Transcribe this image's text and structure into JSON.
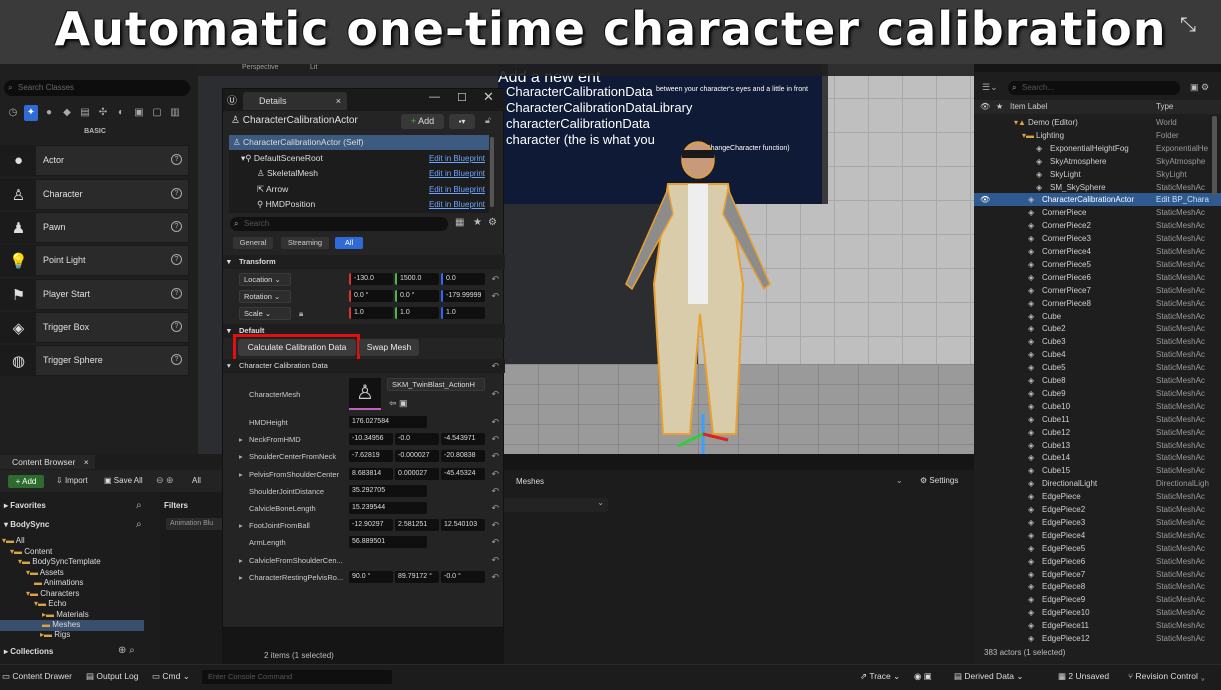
{
  "banner": {
    "title": "Automatic one-time character calibration"
  },
  "place_actors": {
    "search_placeholder": "Search Classes",
    "section": "BASIC",
    "items": [
      {
        "label": "Actor",
        "icon": "sphere-icon"
      },
      {
        "label": "Character",
        "icon": "character-icon"
      },
      {
        "label": "Pawn",
        "icon": "pawn-icon"
      },
      {
        "label": "Point Light",
        "icon": "point-light-icon"
      },
      {
        "label": "Player Start",
        "icon": "player-start-icon"
      },
      {
        "label": "Trigger Box",
        "icon": "trigger-box-icon"
      },
      {
        "label": "Trigger Sphere",
        "icon": "trigger-sphere-icon"
      }
    ]
  },
  "viewport": {
    "perspective_label": "Perspective",
    "lit_label": "Lit",
    "board_lines": [
      "Add a new ent",
      "CharacterCalibrationData",
      "CharacterCalibrationDataLibrary",
      "characterCalibrationData",
      "character (the is what you"
    ],
    "board_right_1": "between your character's eyes and a little in front",
    "board_right_2": "o the ChangeCharacter function)"
  },
  "details": {
    "tab": "Details",
    "actor": "CharacterCalibrationActor",
    "add_label": "Add",
    "components": [
      {
        "label": "CharacterCalibrationActor (Self)",
        "link": ""
      },
      {
        "label": "DefaultSceneRoot",
        "link": "Edit in Blueprint"
      },
      {
        "label": "SkeletalMesh",
        "link": "Edit in Blueprint"
      },
      {
        "label": "Arrow",
        "link": "Edit in Blueprint"
      },
      {
        "label": "HMDPosition",
        "link": "Edit in Blueprint"
      }
    ],
    "search_placeholder": "Search",
    "filters": [
      "General",
      "Streaming",
      "All"
    ],
    "transform_section": "Transform",
    "location": {
      "label": "Location",
      "x": "-130.0",
      "y": "1500.0",
      "z": "0.0"
    },
    "rotation": {
      "label": "Rotation",
      "x": "0.0 °",
      "y": "0.0 °",
      "z": "-179.99999"
    },
    "scale": {
      "label": "Scale",
      "x": "1.0",
      "y": "1.0",
      "z": "1.0"
    },
    "default_section": "Default",
    "calc_button": "Calculate Calibration Data",
    "swap_button": "Swap Mesh",
    "calib_section": "Character Calibration Data",
    "character_mesh_label": "CharacterMesh",
    "character_mesh_value": "SKM_TwinBlast_ActionH",
    "props": [
      {
        "label": "HMDHeight",
        "v": [
          "176.027584"
        ]
      },
      {
        "label": "NeckFromHMD",
        "v": [
          "-10.34956",
          "-0.0",
          "-4.543971"
        ]
      },
      {
        "label": "ShoulderCenterFromNeck",
        "v": [
          "-7.62819",
          "-0.000027",
          "-20.80838"
        ]
      },
      {
        "label": "PelvisFromShoulderCenter",
        "v": [
          "8.683814",
          "0.000027",
          "-45.45324"
        ]
      },
      {
        "label": "ShoulderJointDistance",
        "v": [
          "35.292705"
        ]
      },
      {
        "label": "CalvicleBoneLength",
        "v": [
          "15.239544"
        ]
      },
      {
        "label": "FootJointFromBall",
        "v": [
          "-12.90297",
          "2.581251",
          "12.540103"
        ]
      },
      {
        "label": "ArmLength",
        "v": [
          "56.889501"
        ]
      },
      {
        "label": "CalvicleFromShoulderCen...",
        "v": []
      },
      {
        "label": "CharacterRestingPelvisRo...",
        "v": [
          "90.0 °",
          "89.79172 °",
          "-0.0 °"
        ]
      }
    ]
  },
  "outliner": {
    "search_placeholder": "Search...",
    "col_label": "Item Label",
    "col_type": "Type",
    "footer": "383 actors (1 selected)",
    "rows": [
      {
        "label": "Demo (Editor)",
        "type": "World",
        "indent": 40
      },
      {
        "label": "Lighting",
        "type": "Folder",
        "indent": 48
      },
      {
        "label": "ExponentialHeightFog",
        "type": "ExponentialHe",
        "indent": 62
      },
      {
        "label": "SkyAtmosphere",
        "type": "SkyAtmosphe",
        "indent": 62
      },
      {
        "label": "SkyLight",
        "type": "SkyLight",
        "indent": 62
      },
      {
        "label": "SM_SkySphere",
        "type": "StaticMeshAc",
        "indent": 62
      },
      {
        "label": "CharacterCalibrationActor",
        "type": "Edit BP_Chara",
        "indent": 54,
        "sel": true
      },
      {
        "label": "CornerPiece",
        "type": "StaticMeshAc",
        "indent": 54
      },
      {
        "label": "CornerPiece2",
        "type": "StaticMeshAc",
        "indent": 54
      },
      {
        "label": "CornerPiece3",
        "type": "StaticMeshAc",
        "indent": 54
      },
      {
        "label": "CornerPiece4",
        "type": "StaticMeshAc",
        "indent": 54
      },
      {
        "label": "CornerPiece5",
        "type": "StaticMeshAc",
        "indent": 54
      },
      {
        "label": "CornerPiece6",
        "type": "StaticMeshAc",
        "indent": 54
      },
      {
        "label": "CornerPiece7",
        "type": "StaticMeshAc",
        "indent": 54
      },
      {
        "label": "CornerPiece8",
        "type": "StaticMeshAc",
        "indent": 54
      },
      {
        "label": "Cube",
        "type": "StaticMeshAc",
        "indent": 54
      },
      {
        "label": "Cube2",
        "type": "StaticMeshAc",
        "indent": 54
      },
      {
        "label": "Cube3",
        "type": "StaticMeshAc",
        "indent": 54
      },
      {
        "label": "Cube4",
        "type": "StaticMeshAc",
        "indent": 54
      },
      {
        "label": "Cube5",
        "type": "StaticMeshAc",
        "indent": 54
      },
      {
        "label": "Cube8",
        "type": "StaticMeshAc",
        "indent": 54
      },
      {
        "label": "Cube9",
        "type": "StaticMeshAc",
        "indent": 54
      },
      {
        "label": "Cube10",
        "type": "StaticMeshAc",
        "indent": 54
      },
      {
        "label": "Cube11",
        "type": "StaticMeshAc",
        "indent": 54
      },
      {
        "label": "Cube12",
        "type": "StaticMeshAc",
        "indent": 54
      },
      {
        "label": "Cube13",
        "type": "StaticMeshAc",
        "indent": 54
      },
      {
        "label": "Cube14",
        "type": "StaticMeshAc",
        "indent": 54
      },
      {
        "label": "Cube15",
        "type": "StaticMeshAc",
        "indent": 54
      },
      {
        "label": "DirectionalLight",
        "type": "DirectionalLigh",
        "indent": 54
      },
      {
        "label": "EdgePiece",
        "type": "StaticMeshAc",
        "indent": 54
      },
      {
        "label": "EdgePiece2",
        "type": "StaticMeshAc",
        "indent": 54
      },
      {
        "label": "EdgePiece3",
        "type": "StaticMeshAc",
        "indent": 54
      },
      {
        "label": "EdgePiece4",
        "type": "StaticMeshAc",
        "indent": 54
      },
      {
        "label": "EdgePiece5",
        "type": "StaticMeshAc",
        "indent": 54
      },
      {
        "label": "EdgePiece6",
        "type": "StaticMeshAc",
        "indent": 54
      },
      {
        "label": "EdgePiece7",
        "type": "StaticMeshAc",
        "indent": 54
      },
      {
        "label": "EdgePiece8",
        "type": "StaticMeshAc",
        "indent": 54
      },
      {
        "label": "EdgePiece9",
        "type": "StaticMeshAc",
        "indent": 54
      },
      {
        "label": "EdgePiece10",
        "type": "StaticMeshAc",
        "indent": 54
      },
      {
        "label": "EdgePiece11",
        "type": "StaticMeshAc",
        "indent": 54
      },
      {
        "label": "EdgePiece12",
        "type": "StaticMeshAc",
        "indent": 54
      }
    ]
  },
  "content_browser": {
    "tab": "Content Browser",
    "add": "Add",
    "import": "Import",
    "save_all": "Save All",
    "all_label": "All",
    "favorites": "Favorites",
    "project": "BodySync",
    "filters": "Filters",
    "filter_chip": "Animation Blu",
    "path_meshes": "Meshes",
    "settings": "Settings",
    "items_status": "2 items (1 selected)",
    "collections": "Collections",
    "folders": [
      {
        "label": "All",
        "indent": 2
      },
      {
        "label": "Content",
        "indent": 10
      },
      {
        "label": "BodySyncTemplate",
        "indent": 18
      },
      {
        "label": "Assets",
        "indent": 26
      },
      {
        "label": "Animations",
        "indent": 34
      },
      {
        "label": "Characters",
        "indent": 26
      },
      {
        "label": "Echo",
        "indent": 34
      },
      {
        "label": "Materials",
        "indent": 42
      },
      {
        "label": "Meshes",
        "indent": 42,
        "sel": true
      },
      {
        "label": "Rigs",
        "indent": 42
      }
    ]
  },
  "bottom_bar": {
    "drawer": "Content Drawer",
    "output": "Output Log",
    "cmd": "Cmd",
    "console_placeholder": "Enter Console Command",
    "trace": "Trace",
    "derived": "Derived Data",
    "unsaved": "2 Unsaved",
    "revision": "Revision Control"
  }
}
